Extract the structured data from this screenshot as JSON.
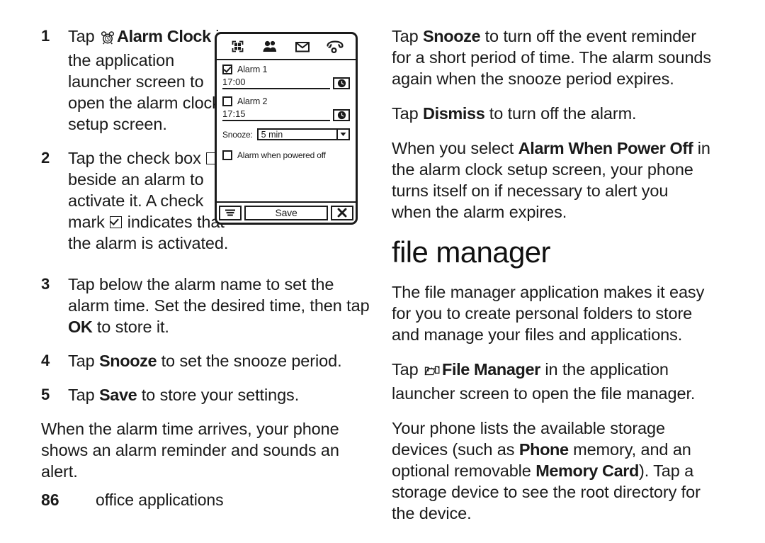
{
  "left_column": {
    "steps": [
      {
        "num": "1",
        "icon": "alarm-clock-icon",
        "pre": "Tap ",
        "bold": "Alarm Clock",
        "post": " in the application launcher screen to open the alarm clock setup screen."
      },
      {
        "num": "2",
        "seg1": "Tap the check box ",
        "seg2": " beside an alarm to activate it. A check mark ",
        "seg3": " indicates that the alarm is activated."
      },
      {
        "num": "3",
        "pre": "Tap below the alarm name to set the alarm time. Set the desired time, then tap ",
        "bold": "OK",
        "post": " to store it."
      },
      {
        "num": "4",
        "pre": "Tap ",
        "bold": "Snooze",
        "post": " to set the snooze period."
      },
      {
        "num": "5",
        "pre": "Tap ",
        "bold": "Save",
        "post": " to store your settings."
      }
    ],
    "closing_paragraph": "When the alarm time arrives, your phone shows an alarm reminder and sounds an alert."
  },
  "right_column": {
    "para_snooze": {
      "pre": "Tap ",
      "bold": "Snooze",
      "post": " to turn off the event reminder for a short period of time. The alarm sounds again when the snooze period expires."
    },
    "para_dismiss": {
      "pre": "Tap ",
      "bold": "Dismiss",
      "post": " to turn off the alarm."
    },
    "para_poweroff": {
      "pre": "When you select ",
      "bold": "Alarm When Power Off",
      "post": " in the alarm clock setup screen, your phone turns itself on if necessary to alert you when the alarm expires."
    },
    "section_heading": "file manager",
    "para_intro": "The file manager application makes it easy for you to create personal folders to store and manage your files and applications.",
    "para_launch": {
      "icon": "file-manager-folder-icon",
      "pre": "Tap ",
      "bold": "File Manager",
      "post": " in the application launcher screen to open the file manager."
    },
    "para_storage": {
      "seg1": "Your phone lists the available storage devices (such as ",
      "bold1": "Phone",
      "seg2": " memory, and an optional removable ",
      "bold2": "Memory Card",
      "seg3": "). Tap a storage device to see the root directory for the device."
    }
  },
  "device_screen": {
    "status_icons": [
      "app-launcher-grid-icon",
      "contacts-people-icon",
      "message-envelope-icon",
      "phone-handset-icon"
    ],
    "alarms": [
      {
        "label": "Alarm 1",
        "time": "17:00",
        "checked": true
      },
      {
        "label": "Alarm 2",
        "time": "17:15",
        "checked": false
      }
    ],
    "snooze": {
      "label": "Snooze:",
      "value": "5 min"
    },
    "power_off": {
      "label": "Alarm when powered off",
      "checked": false
    },
    "softkeys": {
      "menu": "menu-icon",
      "save": "Save",
      "close": "close-x-icon"
    }
  },
  "footer": {
    "page_number": "86",
    "section_title": "office applications"
  },
  "colors": {
    "ink": "#1a1a1a",
    "paper": "#ffffff"
  }
}
